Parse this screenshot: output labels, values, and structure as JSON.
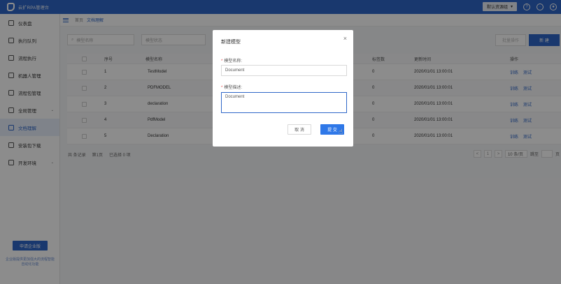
{
  "app": {
    "title": "云扩RPA管理台"
  },
  "topbar": {
    "env_label": "默认资源组",
    "icons": [
      "help-icon",
      "bell-icon",
      "user-icon"
    ]
  },
  "sidebar": {
    "items": [
      {
        "label": "仪表盘",
        "icon": "dashboard-icon"
      },
      {
        "label": "执行队列",
        "icon": "queue-icon"
      },
      {
        "label": "流程执行",
        "icon": "flow-icon"
      },
      {
        "label": "机器人管理",
        "icon": "robot-icon"
      },
      {
        "label": "流程包管理",
        "icon": "package-icon"
      },
      {
        "label": "全局管理",
        "icon": "global-icon",
        "caret": "⌄"
      },
      {
        "label": "文档理解",
        "icon": "document-icon",
        "active": true
      },
      {
        "label": "安装包下载",
        "icon": "download-icon"
      },
      {
        "label": "开发环境",
        "icon": "code-icon",
        "caret": "⌄"
      }
    ],
    "upgrade_label": "申请企业版",
    "upgrade_tip": "企业版提供更加强大的流程智能自动化功能"
  },
  "breadcrumb": {
    "home": "首页",
    "current": "文档理解"
  },
  "toolbar": {
    "search_placeholder": "模型名称",
    "status_placeholder": "模型状态",
    "batch_label": "批量操作",
    "new_label": "新 建"
  },
  "table": {
    "columns": {
      "index": "序号",
      "name": "模型名称",
      "label_count": "标签数",
      "updated": "更新时间",
      "ops": "操作"
    },
    "rows": [
      {
        "index": "1",
        "name": "TestModel",
        "label_count": "0",
        "updated": "2020/01/01 13:00:01"
      },
      {
        "index": "2",
        "name": "PDFMODEL",
        "label_count": "0",
        "updated": "2020/01/01 13:00:01"
      },
      {
        "index": "3",
        "name": "declaration",
        "label_count": "0",
        "updated": "2020/01/01 13:00:01"
      },
      {
        "index": "4",
        "name": "PdfModel",
        "label_count": "0",
        "updated": "2020/01/01 13:00:01"
      },
      {
        "index": "5",
        "name": "Declaration",
        "label_count": "0",
        "updated": "2020/01/01 13:00:01"
      }
    ],
    "op_train": "训练",
    "op_test": "测试"
  },
  "summary": {
    "total": "共 条记录",
    "page": "第1页",
    "selected": "已选择 0 项"
  },
  "pager": {
    "prev": "<",
    "page": "1",
    "next": ">",
    "page_size": "10 条/页",
    "jump_label": "跳至",
    "page_unit": "页"
  },
  "modal": {
    "title": "新建模型",
    "close": "×",
    "name_label": "模型名称:",
    "name_value": "Document",
    "desc_label": "模型描述:",
    "desc_value": "Document",
    "cancel_label": "取 消",
    "submit_label": "提 交"
  }
}
